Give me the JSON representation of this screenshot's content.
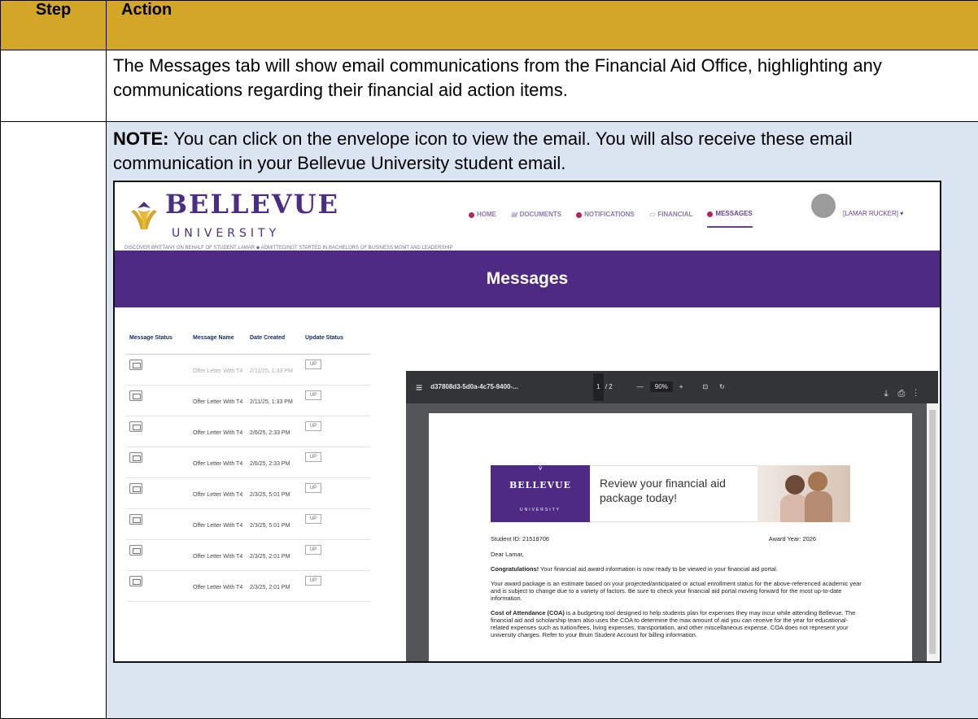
{
  "table": {
    "header_step": "Step",
    "header_action": "Action",
    "row1_text": "The Messages tab will show email communications from the Financial Aid Office, highlighting any communications regarding their financial aid action items.",
    "note_label": "NOTE:",
    "note_text": "  You can click on the envelope icon to view the email.  You will also receive these email communication in your Bellevue University student email."
  },
  "portal": {
    "logo_word": "BELLEVUE",
    "logo_sub": "UNIVERSITY",
    "nav": [
      "HOME",
      "DOCUMENTS",
      "NOTIFICATIONS",
      "FINANCIAL",
      "MESSAGES"
    ],
    "user_name": "[LAMAR RUCKER] ▾",
    "subline": "DISCOVER BRITTANY ON BEHALF OF STUDENT LAMAR     ◆ ADMITTED/NOT STARTED IN BACHELORS OF BUSINESS MGMT AND LEADERSHIP",
    "page_title": "Messages",
    "list_headers": [
      "Message Status",
      "Message Name",
      "Date Created",
      "Update Status"
    ],
    "messages": [
      {
        "name": "Offer Letter With T4",
        "date": "2/11/25, 1:33 PM",
        "update": "UP"
      },
      {
        "name": "Offer Letter With T4",
        "date": "2/11/25, 1:33 PM",
        "update": "UP"
      },
      {
        "name": "Offer Letter With T4",
        "date": "2/6/25, 2:33 PM",
        "update": "UP"
      },
      {
        "name": "Offer Letter With T4",
        "date": "2/6/25, 2:33 PM",
        "update": "UP"
      },
      {
        "name": "Offer Letter With T4",
        "date": "2/3/25, 5:01 PM",
        "update": "UP"
      },
      {
        "name": "Offer Letter With T4",
        "date": "2/3/25, 5:01 PM",
        "update": "UP"
      },
      {
        "name": "Offer Letter With T4",
        "date": "2/3/25, 2:01 PM",
        "update": "UP"
      },
      {
        "name": "Offer Letter With T4",
        "date": "2/3/25, 2:01 PM",
        "update": "UP"
      }
    ]
  },
  "pdf": {
    "filename": "d37808d3-5d0a-4c75-9400-...",
    "page_current": "1",
    "page_total": "/ 2",
    "zoom": "90%",
    "banner_word": "BELLEVUE",
    "banner_sub": "UNIVERSITY",
    "banner_text": "Review your financial aid package today!",
    "student_id": "Student ID: 21518706",
    "award_year": "Award Year: 2026",
    "greeting": "Dear Lamar,",
    "congrats_bold": "Congratulations!",
    "congrats_text": " Your financial aid award information is now ready to be viewed in your financial aid portal.",
    "para2": "Your award package is an estimate based on your projected/anticipated or actual enrollment status for the above-referenced academic year and is subject to change due to a variety of factors. Be sure to check your financial aid portal moving forward for the most up-to-date information.",
    "coa_bold": "Cost of Attendance (COA)",
    "coa_text": " is a budgeting tool designed to help students plan for expenses they may incur while attending Bellevue. The financial aid and scholarship team also uses the COA to determine the max amount of aid you can receive for the year for educational-related expenses such as tuition/fees, living expenses, transportation, and other miscellaneous expense. COA does not represent your university charges. Refer to your Bruin Student Account for billing information."
  },
  "colors": {
    "header_gold": "#d4a627",
    "note_blue": "#dbe5f1",
    "brand_purple": "#4e2a84"
  }
}
